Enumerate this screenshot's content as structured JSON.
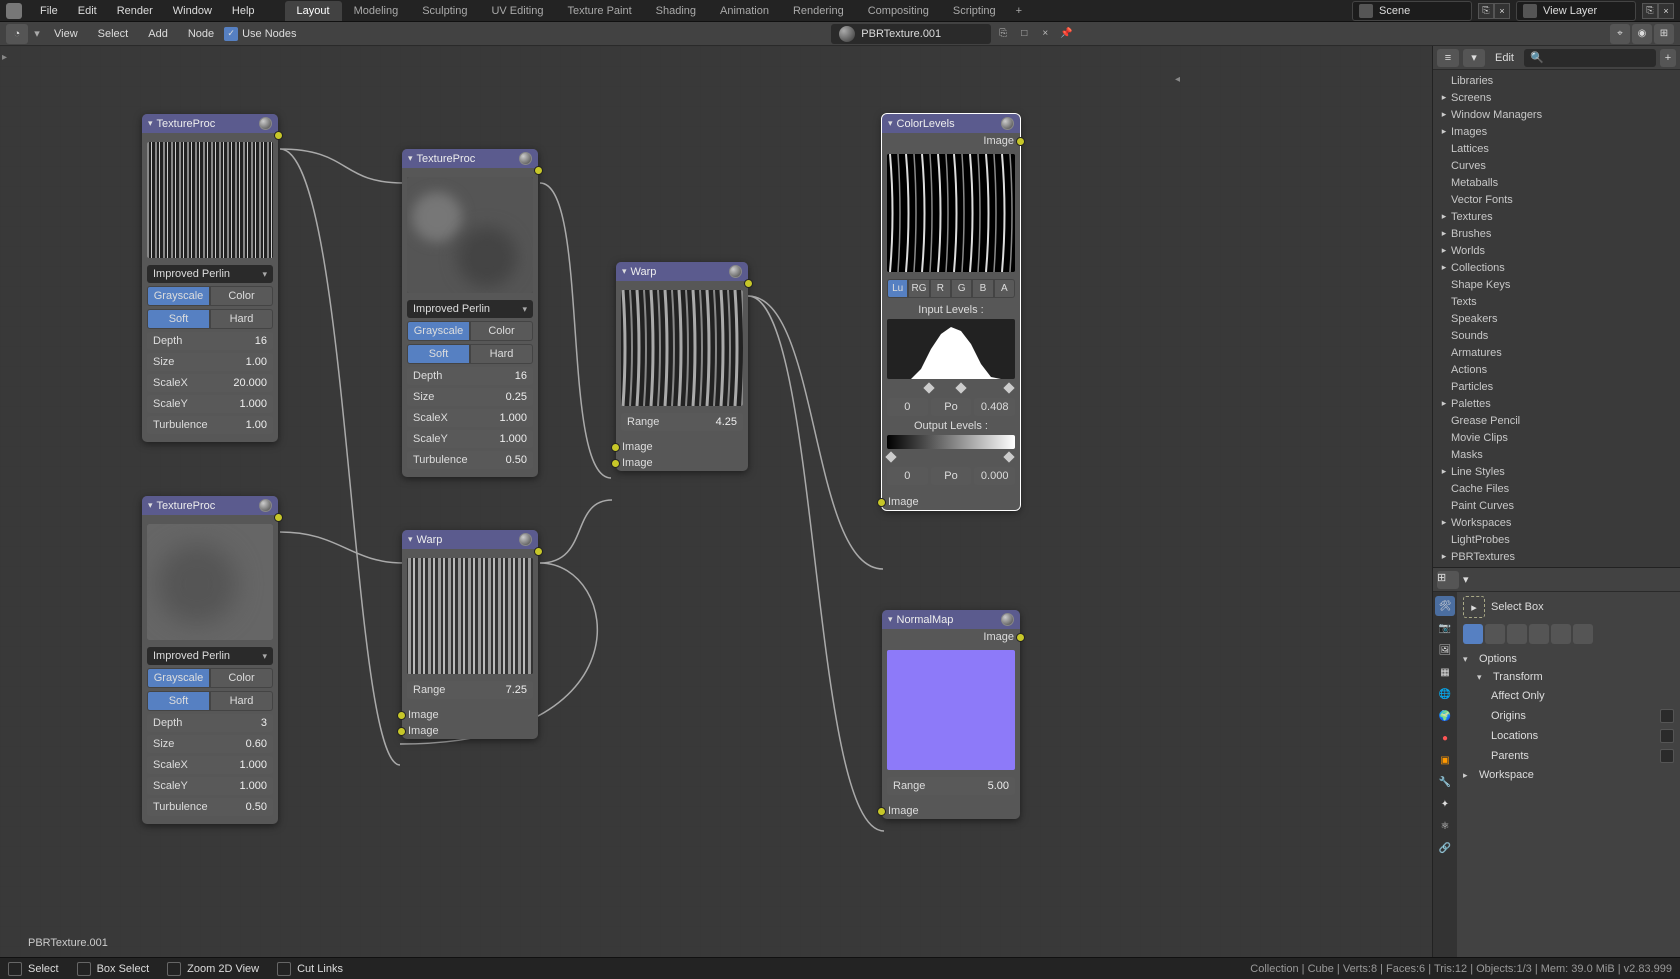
{
  "menus": [
    "File",
    "Edit",
    "Render",
    "Window",
    "Help"
  ],
  "workspace_tabs": [
    "Layout",
    "Modeling",
    "Sculpting",
    "UV Editing",
    "Texture Paint",
    "Shading",
    "Animation",
    "Rendering",
    "Compositing",
    "Scripting"
  ],
  "active_tab": 0,
  "scene_name": "Scene",
  "viewlayer_name": "View Layer",
  "toolbar": {
    "view": "View",
    "select": "Select",
    "add": "Add",
    "node": "Node",
    "use_nodes": "Use Nodes",
    "material": "PBRTexture.001"
  },
  "outliner": {
    "edit": "Edit",
    "items": [
      {
        "label": "Libraries",
        "arr": ""
      },
      {
        "label": "Screens",
        "arr": "▸"
      },
      {
        "label": "Window Managers",
        "arr": "▸"
      },
      {
        "label": "Images",
        "arr": "▸"
      },
      {
        "label": "Lattices",
        "arr": ""
      },
      {
        "label": "Curves",
        "arr": ""
      },
      {
        "label": "Metaballs",
        "arr": ""
      },
      {
        "label": "Vector Fonts",
        "arr": ""
      },
      {
        "label": "Textures",
        "arr": "▸"
      },
      {
        "label": "Brushes",
        "arr": "▸"
      },
      {
        "label": "Worlds",
        "arr": "▸"
      },
      {
        "label": "Collections",
        "arr": "▸"
      },
      {
        "label": "Shape Keys",
        "arr": ""
      },
      {
        "label": "Texts",
        "arr": ""
      },
      {
        "label": "Speakers",
        "arr": ""
      },
      {
        "label": "Sounds",
        "arr": ""
      },
      {
        "label": "Armatures",
        "arr": ""
      },
      {
        "label": "Actions",
        "arr": ""
      },
      {
        "label": "Particles",
        "arr": ""
      },
      {
        "label": "Palettes",
        "arr": "▸"
      },
      {
        "label": "Grease Pencil",
        "arr": ""
      },
      {
        "label": "Movie Clips",
        "arr": ""
      },
      {
        "label": "Masks",
        "arr": ""
      },
      {
        "label": "Line Styles",
        "arr": "▸"
      },
      {
        "label": "Cache Files",
        "arr": ""
      },
      {
        "label": "Paint Curves",
        "arr": ""
      },
      {
        "label": "Workspaces",
        "arr": "▸"
      },
      {
        "label": "LightProbes",
        "arr": ""
      },
      {
        "label": "PBRTextures",
        "arr": "▸"
      }
    ]
  },
  "props": {
    "select_box": "Select Box",
    "options": "Options",
    "transform": "Transform",
    "affect_only": "Affect Only",
    "origins": "Origins",
    "locations": "Locations",
    "parents": "Parents",
    "workspace": "Workspace"
  },
  "breadcrumb": "PBRTexture.001",
  "status": {
    "select": "Select",
    "box": "Box Select",
    "zoom": "Zoom 2D View",
    "cut": "Cut Links",
    "info": "Collection | Cube | Verts:8 | Faces:6 | Tris:12 | Objects:1/3 | Mem: 39.0 MiB | v2.83.999"
  },
  "nodes": {
    "tp1": {
      "title": "TextureProc",
      "dd": "Improved Perlin",
      "gray": "Grayscale",
      "color": "Color",
      "soft": "Soft",
      "hard": "Hard",
      "depth": {
        "k": "Depth",
        "v": "16"
      },
      "size": {
        "k": "Size",
        "v": "1.00"
      },
      "sx": {
        "k": "ScaleX",
        "v": "20.000"
      },
      "sy": {
        "k": "ScaleY",
        "v": "1.000"
      },
      "turb": {
        "k": "Turbulence",
        "v": "1.00"
      }
    },
    "tp2": {
      "title": "TextureProc",
      "dd": "Improved Perlin",
      "gray": "Grayscale",
      "color": "Color",
      "soft": "Soft",
      "hard": "Hard",
      "depth": {
        "k": "Depth",
        "v": "16"
      },
      "size": {
        "k": "Size",
        "v": "0.25"
      },
      "sx": {
        "k": "ScaleX",
        "v": "1.000"
      },
      "sy": {
        "k": "ScaleY",
        "v": "1.000"
      },
      "turb": {
        "k": "Turbulence",
        "v": "0.50"
      }
    },
    "tp3": {
      "title": "TextureProc",
      "dd": "Improved Perlin",
      "gray": "Grayscale",
      "color": "Color",
      "soft": "Soft",
      "hard": "Hard",
      "depth": {
        "k": "Depth",
        "v": "3"
      },
      "size": {
        "k": "Size",
        "v": "0.60"
      },
      "sx": {
        "k": "ScaleX",
        "v": "1.000"
      },
      "sy": {
        "k": "ScaleY",
        "v": "1.000"
      },
      "turb": {
        "k": "Turbulence",
        "v": "0.50"
      }
    },
    "warp1": {
      "title": "Warp",
      "range": {
        "k": "Range",
        "v": "7.25"
      },
      "img": "Image"
    },
    "warp2": {
      "title": "Warp",
      "range": {
        "k": "Range",
        "v": "4.25"
      },
      "img": "Image"
    },
    "color": {
      "title": "ColorLevels",
      "out_img": "Image",
      "channels": [
        "Lu",
        "RG",
        "R",
        "G",
        "B",
        "A"
      ],
      "input_lbl": "Input Levels :",
      "output_lbl": "Output Levels :",
      "in_lo": "0",
      "in_mid": "Po",
      "in_hi": "0.408",
      "out_lo": "0",
      "out_mid": "Po",
      "out_hi": "0.000",
      "in_img": "Image"
    },
    "normal": {
      "title": "NormalMap",
      "out_img": "Image",
      "range": {
        "k": "Range",
        "v": "5.00"
      },
      "in_img": "Image"
    }
  }
}
